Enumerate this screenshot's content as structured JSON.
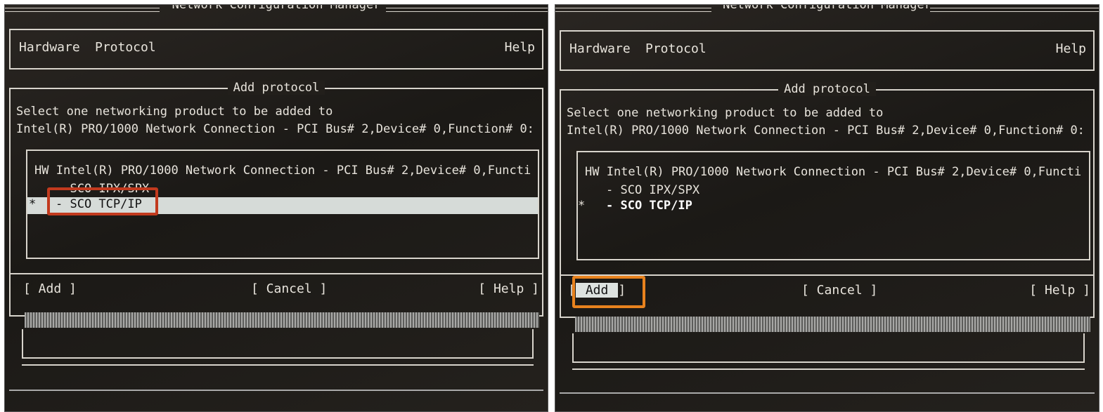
{
  "panels": [
    {
      "title": "Network Configuration Manager",
      "menu": {
        "hardware": "Hardware",
        "protocol": "Protocol",
        "help": "Help"
      },
      "dialog": {
        "title": "Add protocol",
        "prompt_line1": "Select one networking product to be added to",
        "prompt_line2": "Intel(R) PRO/1000 Network Connection - PCI Bus# 2,Device# 0,Function# 0:",
        "list": {
          "hw_row": "HW Intel(R) PRO/1000 Network Connection - PCI Bus# 2,Device# 0,Functi",
          "ipx_row": "- SCO IPX/SPX",
          "tcp_marker": "*",
          "tcp_row": "- SCO TCP/IP"
        },
        "buttons": {
          "add": "[  Add   ]",
          "cancel": "[ Cancel ]",
          "help": "[  Help  ]"
        }
      },
      "highlight_color": "#c23a1e"
    },
    {
      "title": "Network Configuration Manager",
      "menu": {
        "hardware": "Hardware",
        "protocol": "Protocol",
        "help": "Help"
      },
      "dialog": {
        "title": "Add protocol",
        "prompt_line1": "Select one networking product to be added to",
        "prompt_line2": "Intel(R) PRO/1000 Network Connection - PCI Bus# 2,Device# 0,Function# 0:",
        "list": {
          "hw_row": "HW Intel(R) PRO/1000 Network Connection - PCI Bus# 2,Device# 0,Functi",
          "ipx_row": "- SCO IPX/SPX",
          "tcp_marker": "*",
          "tcp_row": "- SCO TCP/IP"
        },
        "buttons": {
          "add": "Add",
          "add_left_bracket": "[",
          "add_right_bracket": "]",
          "cancel": "[ Cancel ]",
          "help": "[  Help  ]"
        }
      },
      "highlight_color": "#e8821e"
    }
  ]
}
